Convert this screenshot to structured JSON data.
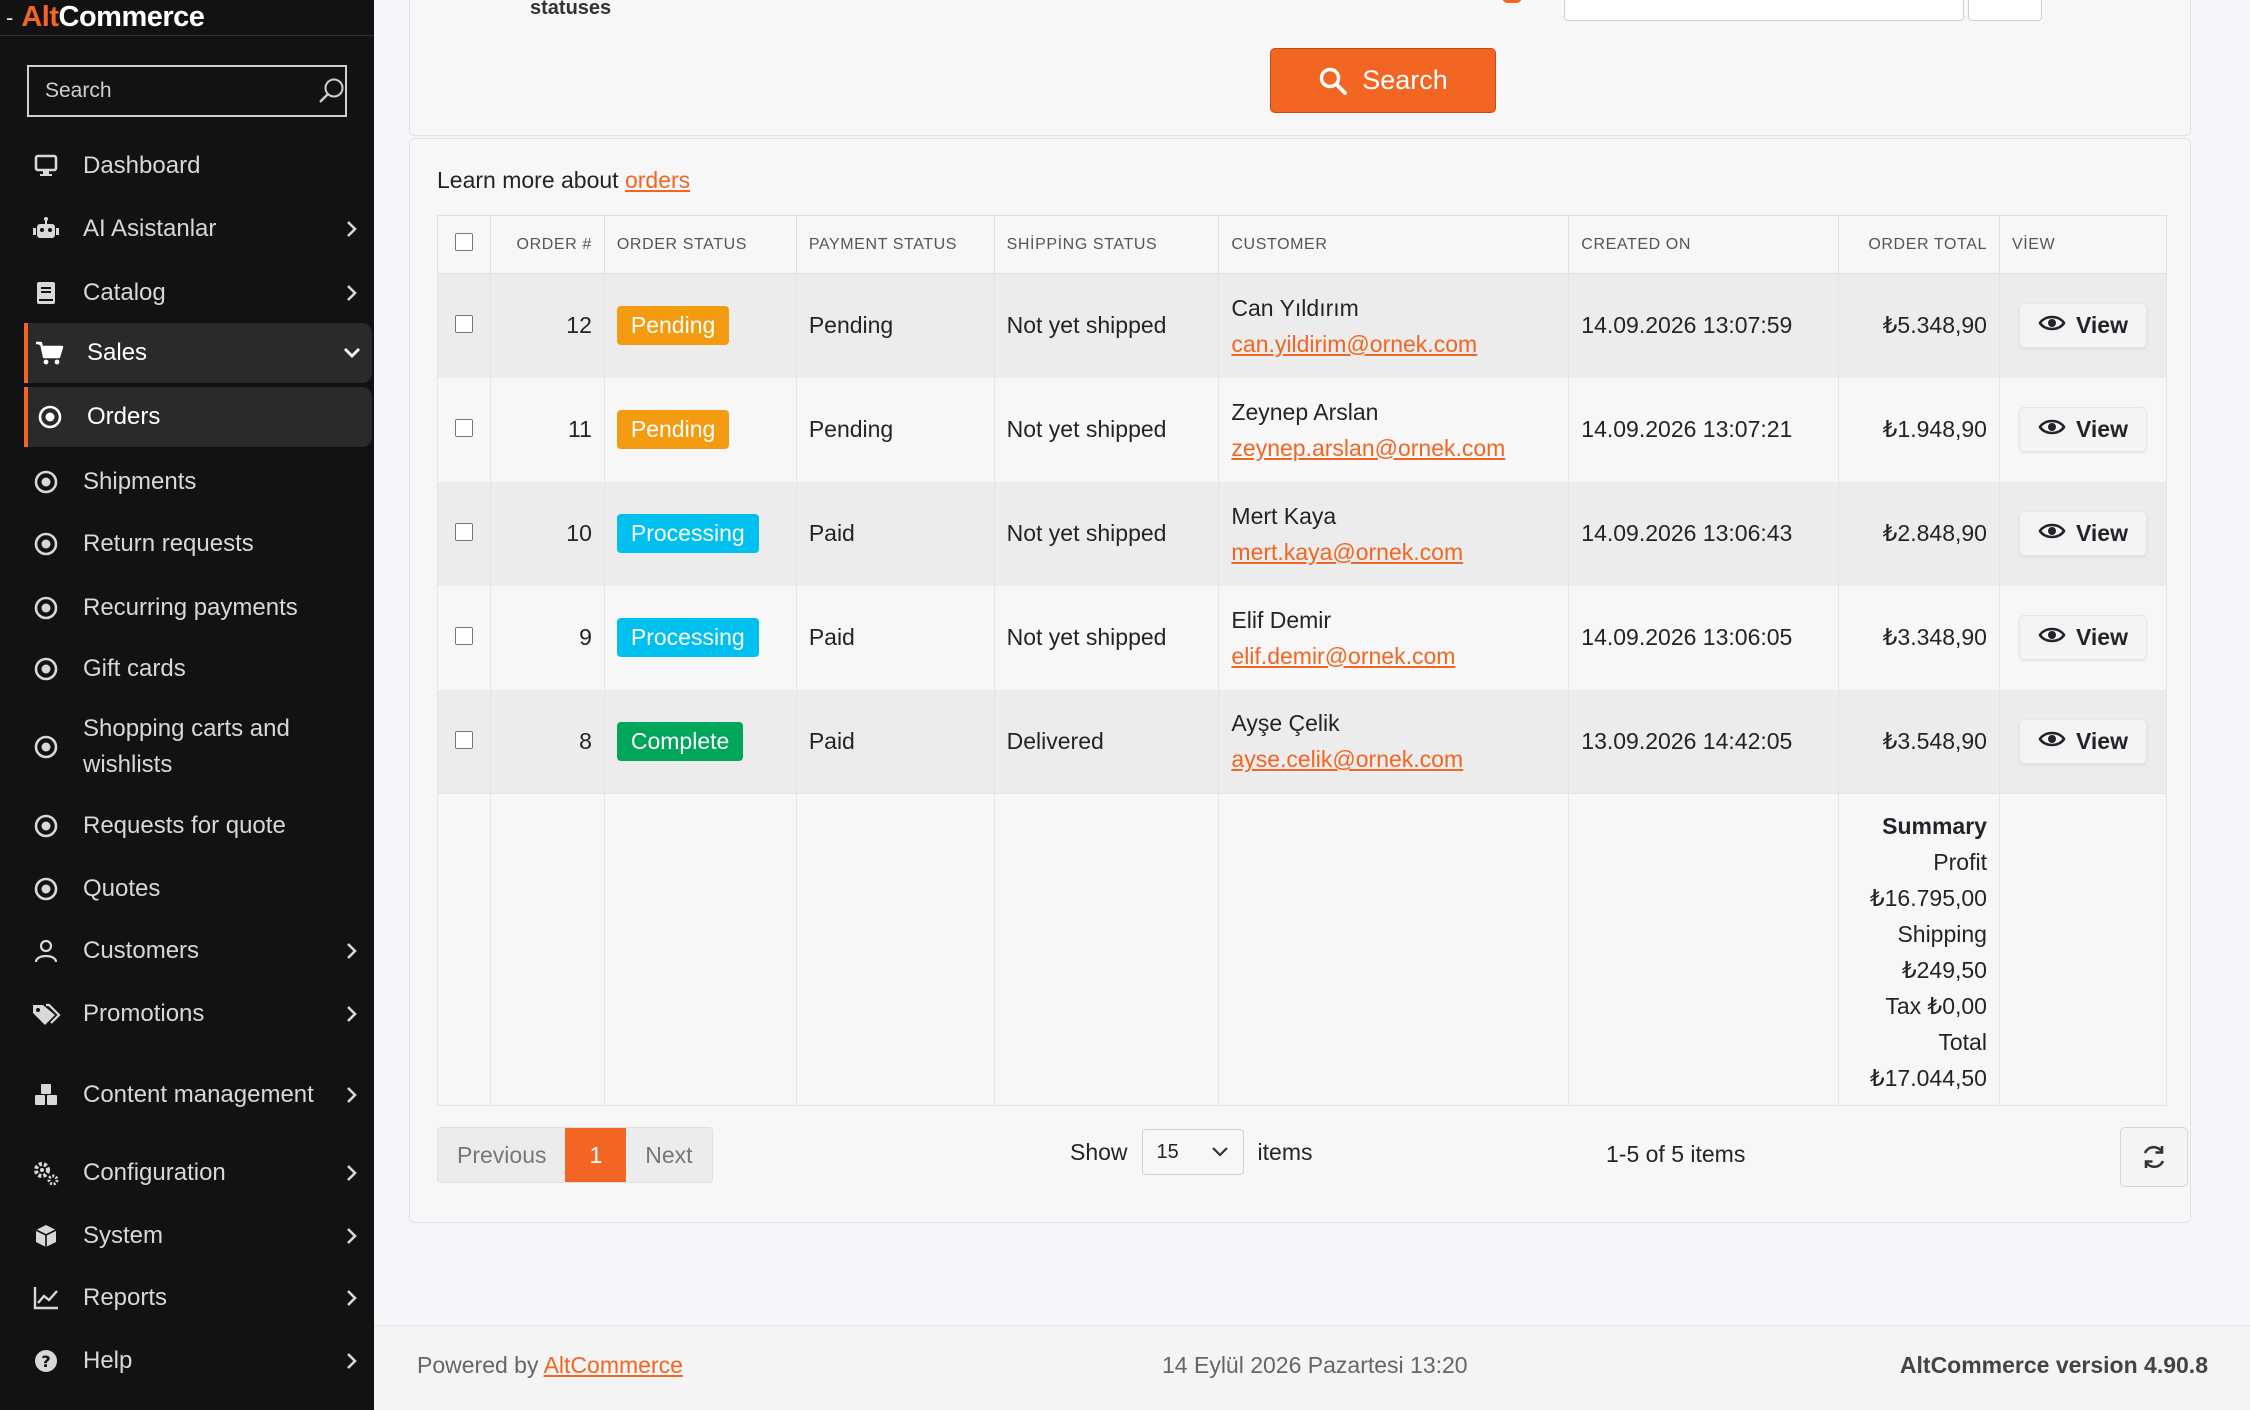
{
  "brand": {
    "prefix": "-",
    "part1": "Alt",
    "part2": "Commerce"
  },
  "sidebar": {
    "search_placeholder": "Search",
    "items": [
      {
        "label": "Dashboard",
        "icon": "monitor-icon",
        "chevron": ""
      },
      {
        "label": "AI Asistanlar",
        "icon": "robot-icon",
        "chevron": "right"
      },
      {
        "label": "Catalog",
        "icon": "book-icon",
        "chevron": "right"
      },
      {
        "label": "Sales",
        "icon": "cart-icon",
        "chevron": "down"
      },
      {
        "label": "Orders",
        "icon": "circle-dot-icon",
        "chevron": ""
      },
      {
        "label": "Shipments",
        "icon": "circle-dot-icon",
        "chevron": ""
      },
      {
        "label": "Return requests",
        "icon": "circle-dot-icon",
        "chevron": ""
      },
      {
        "label": "Recurring payments",
        "icon": "circle-dot-icon",
        "chevron": ""
      },
      {
        "label": "Gift cards",
        "icon": "circle-dot-icon",
        "chevron": ""
      },
      {
        "label": "Shopping carts and wishlists",
        "icon": "circle-dot-icon",
        "chevron": ""
      },
      {
        "label": "Requests for quote",
        "icon": "circle-dot-icon",
        "chevron": ""
      },
      {
        "label": "Quotes",
        "icon": "circle-dot-icon",
        "chevron": ""
      },
      {
        "label": "Customers",
        "icon": "user-icon",
        "chevron": "right"
      },
      {
        "label": "Promotions",
        "icon": "tags-icon",
        "chevron": "right"
      },
      {
        "label": "Content management",
        "icon": "cubes-icon",
        "chevron": "right"
      },
      {
        "label": "Configuration",
        "icon": "gears-icon",
        "chevron": "right"
      },
      {
        "label": "System",
        "icon": "cube-icon",
        "chevron": "right"
      },
      {
        "label": "Reports",
        "icon": "chart-line-icon",
        "chevron": "right"
      },
      {
        "label": "Help",
        "icon": "question-circle-icon",
        "chevron": "right"
      }
    ]
  },
  "search_panel": {
    "cut_label": "statuses",
    "search_button": "Search"
  },
  "learn_more": {
    "text": "Learn more about ",
    "link": "orders"
  },
  "table": {
    "headers": [
      "ORDER #",
      "ORDER STATUS",
      "PAYMENT STATUS",
      "SHİPPİNG STATUS",
      "CUSTOMER",
      "CREATED ON",
      "ORDER TOTAL",
      "VİEW"
    ],
    "rows": [
      {
        "order": "12",
        "status": "Pending",
        "status_color": "#f39c12",
        "payment": "Pending",
        "shipping": "Not yet shipped",
        "customer": "Can Yıldırım",
        "email": "can.yildirim@ornek.com",
        "created": "14.09.2026 13:07:59",
        "total": "₺5.348,90",
        "view": "View"
      },
      {
        "order": "11",
        "status": "Pending",
        "status_color": "#f39c12",
        "payment": "Pending",
        "shipping": "Not yet shipped",
        "customer": "Zeynep Arslan",
        "email": "zeynep.arslan@ornek.com",
        "created": "14.09.2026 13:07:21",
        "total": "₺1.948,90",
        "view": "View"
      },
      {
        "order": "10",
        "status": "Processing",
        "status_color": "#00c0ef",
        "payment": "Paid",
        "shipping": "Not yet shipped",
        "customer": "Mert Kaya",
        "email": "mert.kaya@ornek.com",
        "created": "14.09.2026 13:06:43",
        "total": "₺2.848,90",
        "view": "View"
      },
      {
        "order": "9",
        "status": "Processing",
        "status_color": "#00c0ef",
        "payment": "Paid",
        "shipping": "Not yet shipped",
        "customer": "Elif Demir",
        "email": "elif.demir@ornek.com",
        "created": "14.09.2026 13:06:05",
        "total": "₺3.348,90",
        "view": "View"
      },
      {
        "order": "8",
        "status": "Complete",
        "status_color": "#00a65a",
        "payment": "Paid",
        "shipping": "Delivered",
        "customer": "Ayşe Çelik",
        "email": "ayse.celik@ornek.com",
        "created": "13.09.2026 14:42:05",
        "total": "₺3.548,90",
        "view": "View"
      }
    ],
    "summary": {
      "title": "Summary",
      "lines": [
        "Profit",
        "₺16.795,00",
        "Shipping",
        "₺249,50",
        "Tax ₺0,00",
        "Total",
        "₺17.044,50"
      ]
    }
  },
  "pager": {
    "previous": "Previous",
    "current": "1",
    "next": "Next"
  },
  "page_size": {
    "show_label": "Show",
    "value": "15",
    "items_label": "items"
  },
  "range_text": "1-5 of 5 items",
  "footer": {
    "powered_by": "Powered by ",
    "powered_link": "AltCommerce",
    "datetime": "14 Eylül 2026 Pazartesi 13:20",
    "version": "AltCommerce version 4.90.8"
  },
  "colors": {
    "accent": "#f26522",
    "sidebar_bg": "#121212",
    "pending": "#f39c12",
    "processing": "#00c0ef",
    "complete": "#00a65a"
  }
}
